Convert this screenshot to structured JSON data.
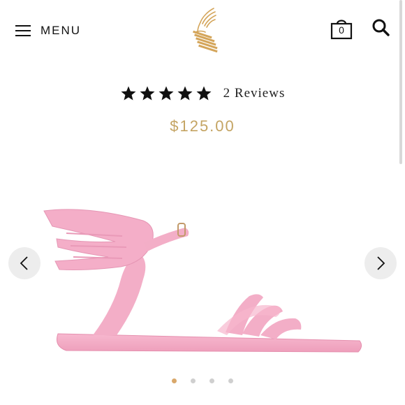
{
  "header": {
    "menu_label": "MENU",
    "cart_count": "0",
    "logo_icon": "ancient-greek-sandals-logo",
    "search_icon": "search-icon",
    "cart_icon": "shopping-bag-icon"
  },
  "product": {
    "rating": 5,
    "rating_max": 5,
    "reviews_label": "2 Reviews",
    "price": "$125.00",
    "image": "pink winged jelly sandal",
    "color": "#f4a9c3"
  },
  "carousel": {
    "slide_count": 4,
    "active_index": 0
  },
  "colors": {
    "price": "#c4a463",
    "active_dot": "#d9a86b",
    "inactive_dot": "#cfcfcf"
  }
}
